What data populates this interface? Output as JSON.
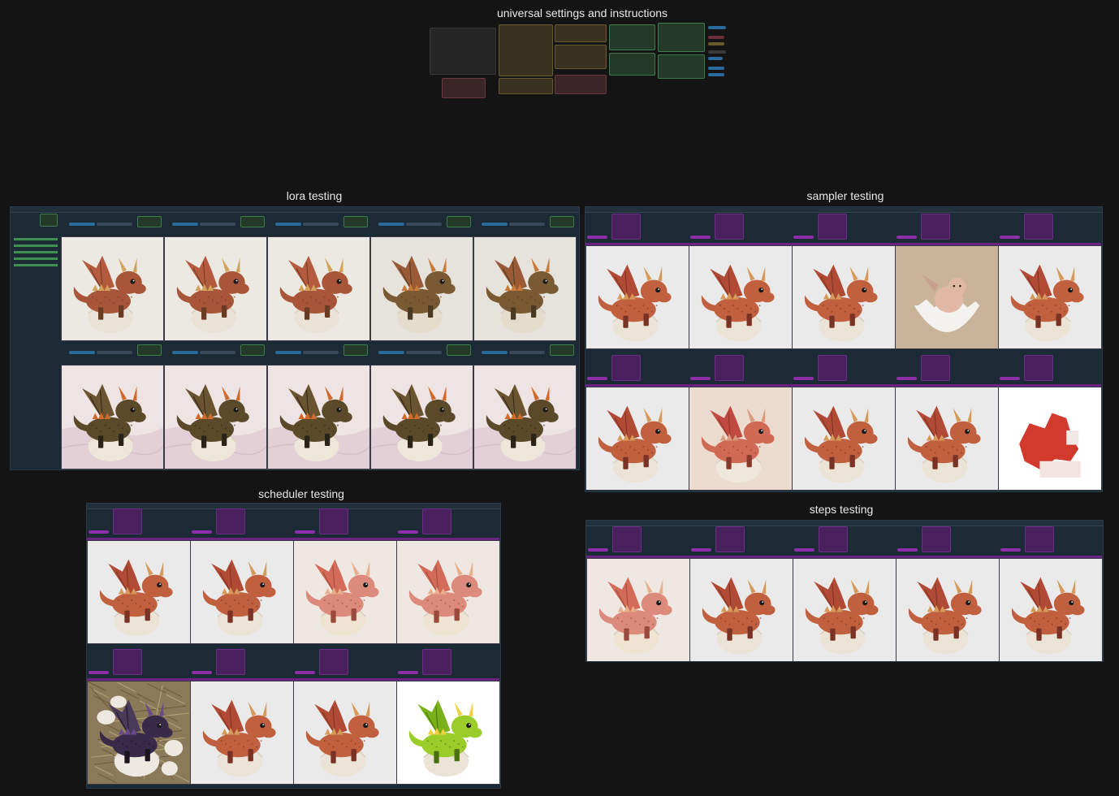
{
  "groups": {
    "universal": {
      "title": "universal settings and instructions"
    },
    "lora": {
      "title": "lora testing"
    },
    "sampler": {
      "title": "sampler testing"
    },
    "scheduler": {
      "title": "scheduler testing"
    },
    "steps": {
      "title": "steps testing"
    }
  },
  "colors": {
    "canvas": "#141414",
    "panel": "#1c2a36",
    "node_purple": "#4a1f5e",
    "node_green": "#233a29",
    "accent_purple": "#8d2fa8",
    "accent_blue": "#2a6a9a",
    "title_text": "#e8e8e8"
  },
  "images": {
    "lora": [
      "dragon-bronze",
      "dragon-bronze",
      "dragon-bronze",
      "dragon-olive",
      "dragon-olive",
      "dragon-dark-pink-bed",
      "dragon-dark-pink-bed",
      "dragon-dark-pink-bed",
      "dragon-dark-pink-bed",
      "dragon-dark-pink-bed"
    ],
    "sampler": [
      "dragon-red",
      "dragon-red",
      "dragon-red",
      "baby-in-egg",
      "dragon-red",
      "dragon-red",
      "dragon-pink",
      "dragon-red",
      "dragon-red",
      "red-blob"
    ],
    "scheduler": [
      "dragon-red",
      "dragon-red",
      "dragon-pink-soft",
      "dragon-pink-soft",
      "dragon-nest",
      "dragon-red",
      "dragon-red",
      "dragon-green"
    ],
    "steps": [
      "dragon-pink-soft",
      "dragon-red",
      "dragon-red",
      "dragon-red",
      "dragon-red"
    ]
  }
}
